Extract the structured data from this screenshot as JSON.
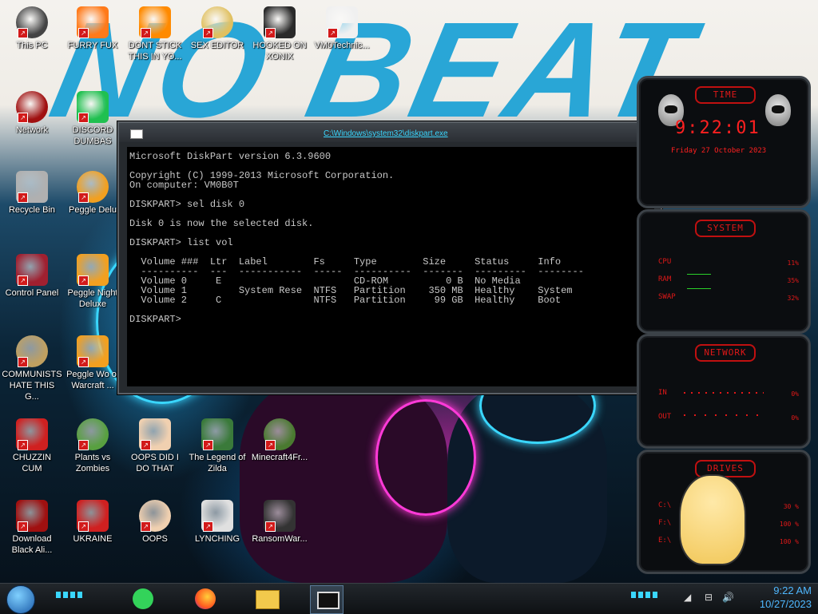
{
  "desktop": {
    "icons": [
      {
        "label": "This PC"
      },
      {
        "label": "FURRY FUX"
      },
      {
        "label": "DONT STICK THIS IN YO..."
      },
      {
        "label": "SEX EDITOR"
      },
      {
        "label": "HOOKED ON XONIX"
      },
      {
        "label": "VM0Technic..."
      },
      {
        "label": "Network"
      },
      {
        "label": "DISCORD DUMBAS"
      },
      {
        "label": "Recycle Bin"
      },
      {
        "label": "Peggle Delu"
      },
      {
        "label": "Control Panel"
      },
      {
        "label": "Peggle Night Deluxe"
      },
      {
        "label": "COMMUNISTS HATE THIS G..."
      },
      {
        "label": "Peggle Wo of Warcraft ..."
      },
      {
        "label": "CHUZZIN CUM"
      },
      {
        "label": "Plants vs Zombies"
      },
      {
        "label": "OOPS DID I DO THAT"
      },
      {
        "label": "The Legend of Zilda"
      },
      {
        "label": "Minecraft4Fr..."
      },
      {
        "label": "Download Black Ali..."
      },
      {
        "label": "UKRAINE"
      },
      {
        "label": "OOPS"
      },
      {
        "label": "LYNCHING"
      },
      {
        "label": "RansomWar..."
      }
    ]
  },
  "console": {
    "title": "C:\\Windows\\system32\\diskpart.exe",
    "lines": [
      "Microsoft DiskPart version 6.3.9600",
      "",
      "Copyright (C) 1999-2013 Microsoft Corporation.",
      "On computer: VM0B0T",
      "",
      "DISKPART> sel disk 0",
      "",
      "Disk 0 is now the selected disk.",
      "",
      "DISKPART> list vol",
      "",
      "  Volume ###  Ltr  Label        Fs     Type        Size     Status     Info",
      "  ----------  ---  -----------  -----  ----------  -------  ---------  --------",
      "  Volume 0     E                       CD-ROM          0 B  No Media",
      "  Volume 1         System Rese  NTFS   Partition    350 MB  Healthy    System",
      "  Volume 2     C                NTFS   Partition     99 GB  Healthy    Boot",
      "",
      "DISKPART> "
    ]
  },
  "gadgets": {
    "time": {
      "title": "TIME",
      "clock": "9:22:01",
      "date": "Friday 27 October 2023"
    },
    "system": {
      "title": "SYSTEM",
      "rows": [
        {
          "label": "CPU",
          "value": "11%"
        },
        {
          "label": "RAM",
          "value": "35%"
        },
        {
          "label": "SWAP",
          "value": "32%"
        }
      ]
    },
    "network": {
      "title": "NETWORK",
      "rows": [
        {
          "label": "IN",
          "value": "0%"
        },
        {
          "label": "OUT",
          "value": "0%"
        }
      ]
    },
    "drives": {
      "title": "DRIVES",
      "rows": [
        {
          "label": "C:\\",
          "value": "30 %"
        },
        {
          "label": "F:\\",
          "value": "100 %"
        },
        {
          "label": "E:\\",
          "value": "100 %"
        }
      ]
    }
  },
  "taskbar": {
    "time": "9:22 AM",
    "date": "10/27/2023"
  },
  "colors": {
    "accent": "#3ad7ff",
    "gadget_red": "#e01818",
    "clock_blue": "#4fb8ff"
  }
}
